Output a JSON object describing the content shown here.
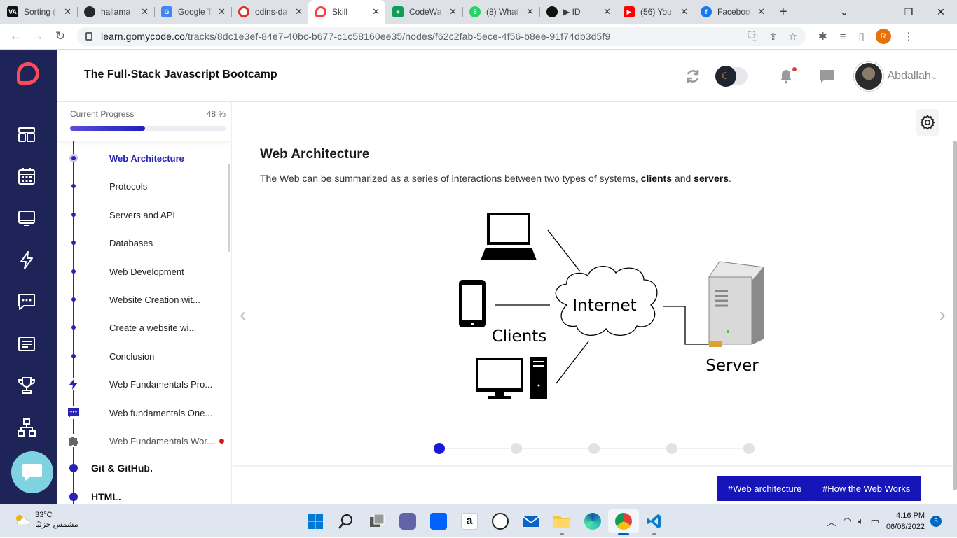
{
  "browser": {
    "tabs": [
      {
        "title": "Sorting (",
        "favicon": "VA",
        "color": "#111111"
      },
      {
        "title": "hallama",
        "favicon": "github-icon",
        "color": "#24292f"
      },
      {
        "title": "Google T",
        "favicon": "google-translate-icon",
        "color": "#4285f4"
      },
      {
        "title": "odins-da",
        "favicon": "odin-icon",
        "color": "#d93025"
      },
      {
        "title": "Skill",
        "favicon": "gomycode-icon",
        "color": "#ff3b47",
        "active": true
      },
      {
        "title": "CodeWa",
        "favicon": "sheets-icon",
        "color": "#0f9d58"
      },
      {
        "title": "(8) What",
        "favicon": "whatsapp-icon",
        "color": "#25d366"
      },
      {
        "title": "▶ ID",
        "favicon": "media-icon",
        "color": "#111111"
      },
      {
        "title": "(56) You",
        "favicon": "youtube-icon",
        "color": "#ff0000"
      },
      {
        "title": "Faceboo",
        "favicon": "facebook-icon",
        "color": "#1877f2"
      }
    ],
    "url_host": "learn.gomycode.co",
    "url_path": "/tracks/8dc1e3ef-84e7-40bc-b677-c1c58160ee35/nodes/f62c2fab-5ece-4f56-b8ee-91f74db3d5f9",
    "profile_initial": "R"
  },
  "header": {
    "course_title": "The Full-Stack Javascript Bootcamp",
    "username": "Abdallah"
  },
  "sidebar": {
    "progress_label": "Current Progress",
    "progress_value": "48 %",
    "progress_fraction": 0.48,
    "items": [
      {
        "label": "Web Architecture",
        "state": "active"
      },
      {
        "label": "Protocols"
      },
      {
        "label": "Servers and API"
      },
      {
        "label": "Databases"
      },
      {
        "label": "Web Development"
      },
      {
        "label": "Website Creation wit..."
      },
      {
        "label": "Create a website wi..."
      },
      {
        "label": "Conclusion"
      },
      {
        "label": "Web Fundamentals Pro...",
        "icon": "lightning-icon"
      },
      {
        "label": "Web fundamentals One...",
        "icon": "chat-icon"
      },
      {
        "label": "Web Fundamentals Wor...",
        "icon": "puzzle-icon"
      }
    ],
    "sections": [
      "Git & GitHub.",
      "HTML."
    ]
  },
  "lesson": {
    "title": "Web Architecture",
    "text_before": "The Web can be summarized as a series of interactions between two types of systems, ",
    "bold1": "clients",
    "text_mid": " and ",
    "bold2": "servers",
    "text_after": ".",
    "diagram": {
      "internet_label": "Internet",
      "clients_label": "Clients",
      "server_label": "Server"
    },
    "step_count": 5,
    "current_step": 1,
    "tags": [
      "#Web architecture",
      "#How the Web Works"
    ]
  },
  "taskbar": {
    "temperature": "33°C",
    "weather_text": "مشمس جزئيًا",
    "time": "4:16 PM",
    "date": "06/08/2022",
    "notifications": "5"
  },
  "colors": {
    "nav_bg": "#1e2358",
    "accent": "#2623b5",
    "tag_bg": "#1515b8",
    "brand_red": "#ff4b55"
  }
}
